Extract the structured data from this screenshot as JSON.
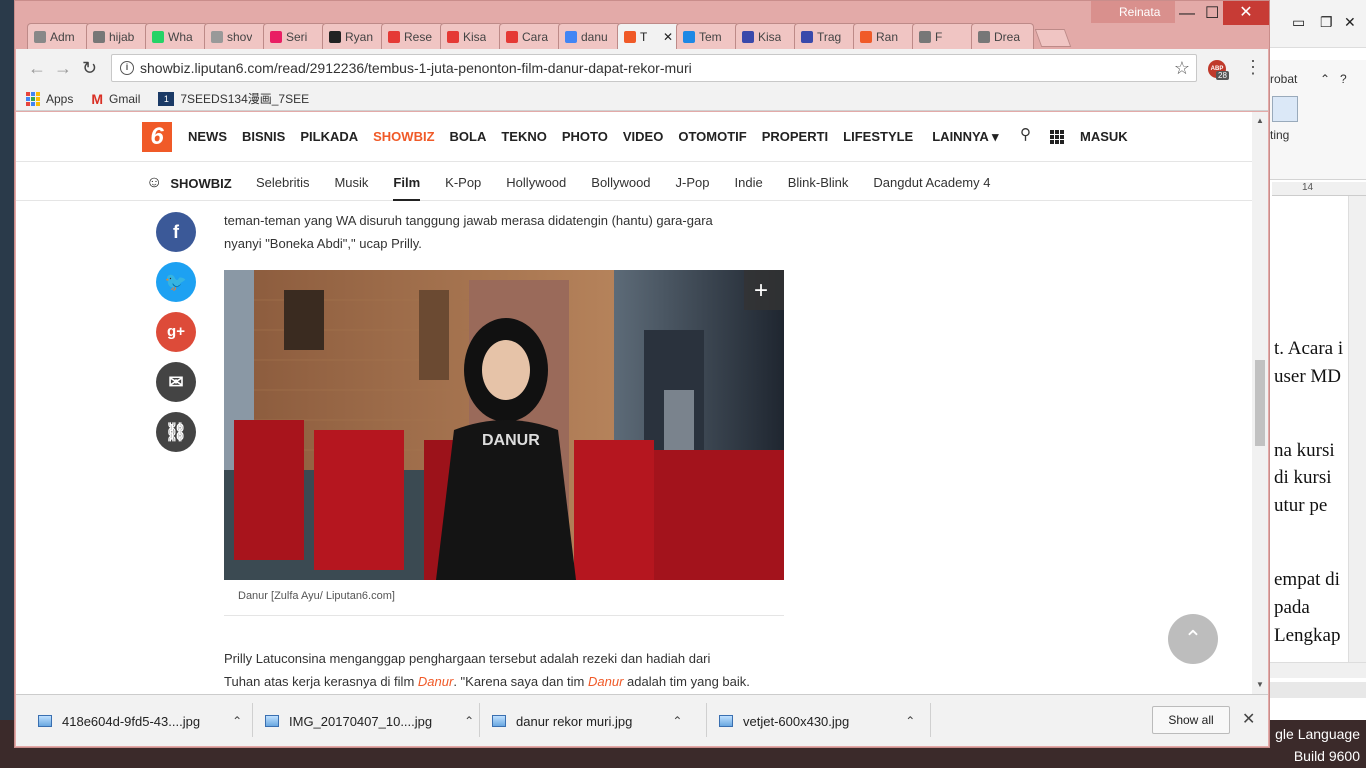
{
  "background_app": {
    "ribbon_label": "robat",
    "ribbon_btn": "ting",
    "ruler": "14",
    "doc_lines": [
      "t. Acara i",
      "user MD",
      "na kursi",
      " di kursi",
      "utur pe",
      "empat di",
      "pada",
      "Lengkap"
    ],
    "desktop_lines": [
      "gle Language",
      "Build 9600"
    ]
  },
  "browser": {
    "profile_name": "Reinata",
    "tabs": [
      {
        "label": "Adm",
        "color": "#888888"
      },
      {
        "label": "hijab",
        "color": "#777777"
      },
      {
        "label": "Wha",
        "color": "#25d366"
      },
      {
        "label": "shov",
        "color": "#999999"
      },
      {
        "label": "Seri",
        "color": "#e91e63"
      },
      {
        "label": "Ryan",
        "color": "#222222"
      },
      {
        "label": "Rese",
        "color": "#e53935"
      },
      {
        "label": "Kisa",
        "color": "#e53935"
      },
      {
        "label": "Cara",
        "color": "#e53935"
      },
      {
        "label": "danu",
        "color": "#4285f4"
      },
      {
        "label": "T",
        "color": "#f05a28"
      },
      {
        "label": "Tem",
        "color": "#1e88e5"
      },
      {
        "label": "Kisa",
        "color": "#3949ab"
      },
      {
        "label": "Trag",
        "color": "#3949ab"
      },
      {
        "label": "Ran",
        "color": "#f05a28"
      },
      {
        "label": "F",
        "color": "#777777"
      },
      {
        "label": "Drea",
        "color": "#777777"
      }
    ],
    "url": "showbiz.liputan6.com/read/2912236/tembus-1-juta-penonton-film-danur-dapat-rekor-muri",
    "abp_count": "28",
    "bookmarks": [
      {
        "label": "Apps"
      },
      {
        "label": "Gmail"
      },
      {
        "label": "7SEEDS134漫画_7SEE"
      }
    ]
  },
  "site": {
    "logo": "6",
    "nav": [
      "NEWS",
      "BISNIS",
      "PILKADA",
      "SHOWBIZ",
      "BOLA",
      "TEKNO",
      "PHOTO",
      "VIDEO",
      "OTOMOTIF",
      "PROPERTI",
      "LIFESTYLE",
      "LAINNYA ▾"
    ],
    "login": "MASUK",
    "section": "SHOWBIZ",
    "subnav": [
      "Selebritis",
      "Musik",
      "Film",
      "K-Pop",
      "Hollywood",
      "Bollywood",
      "J-Pop",
      "Indie",
      "Blink-Blink",
      "Dangdut Academy 4"
    ]
  },
  "article": {
    "para1_line2": "teman-teman yang WA disuruh tanggung jawab merasa didatengin (hantu) gara-gara",
    "para1_line3": "nyanyi \"Boneka Abdi\",\" ucap Prilly.",
    "photo_text": "DANUR",
    "caption": "Danur [Zulfa Ayu/ Liputan6.com]",
    "para2_a": "Prilly Latuconsina menganggap penghargaan tersebut adalah rezeki dan hadiah dari",
    "para2_b": "Tuhan atas kerja kerasnya di film ",
    "para2_em1": "Danur",
    "para2_c": ". \"Karena saya dan tim ",
    "para2_em2": "Danur",
    "para2_d": " adalah tim yang baik."
  },
  "share": {
    "colors": {
      "facebook": "#3b5998",
      "twitter": "#1da1f2",
      "gplus": "#dd4b39",
      "email": "#444444",
      "link": "#444444"
    }
  },
  "downloads": {
    "items": [
      "418e604d-9fd5-43....jpg",
      "IMG_20170407_10....jpg",
      "danur rekor muri.jpg",
      "vetjet-600x430.jpg"
    ],
    "show_all": "Show all"
  }
}
